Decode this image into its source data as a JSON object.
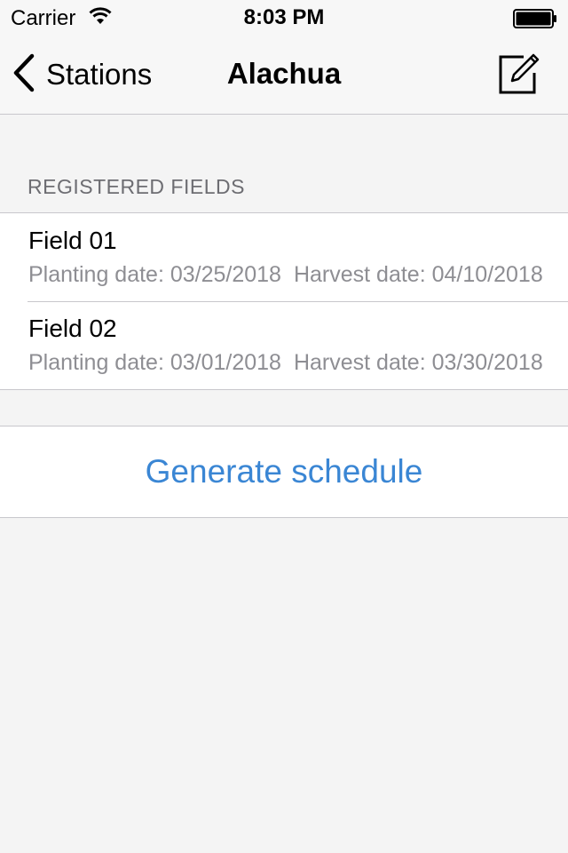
{
  "status_bar": {
    "carrier": "Carrier",
    "time": "8:03 PM"
  },
  "nav": {
    "back_label": "Stations",
    "title": "Alachua",
    "edit_icon": "compose-icon"
  },
  "section": {
    "header": "REGISTERED FIELDS"
  },
  "fields": [
    {
      "name": "Field 01",
      "planting": "Planting date: 03/25/2018",
      "harvest": "Harvest date: 04/10/2018"
    },
    {
      "name": "Field 02",
      "planting": "Planting date: 03/01/2018",
      "harvest": "Harvest date: 03/30/2018"
    }
  ],
  "actions": {
    "generate_label": "Generate schedule"
  },
  "colors": {
    "accent": "#3a86d4",
    "background": "#f4f4f4",
    "secondary_text": "#8e8e93",
    "separator": "#c8c7cc"
  }
}
